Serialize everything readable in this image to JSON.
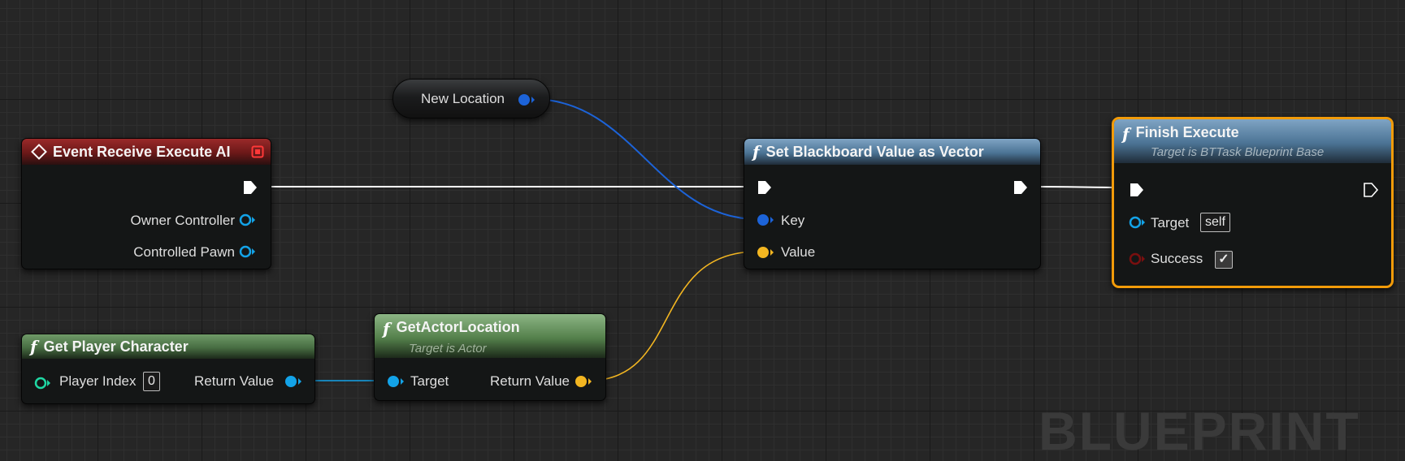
{
  "colors": {
    "exec_wire": "#ffffff",
    "vector_wire": "#f3b621",
    "blackboard_key_wire": "#1c63d8",
    "object_wire": "#13a3e8",
    "selected_outline": "#f29b09",
    "event_header": "#8b2020",
    "function_header": "#4b7394",
    "pure_header": "#476d42"
  },
  "variable_node": {
    "label": "New Location",
    "pin_type": "blackboard-key"
  },
  "event_node": {
    "title": "Event Receive Execute AI",
    "icon": "diamond-event-icon",
    "pins": {
      "owner_controller": "Owner Controller",
      "controlled_pawn": "Controlled Pawn"
    }
  },
  "set_node": {
    "title": "Set Blackboard Value as Vector",
    "icon": "function-icon",
    "pins": {
      "key": "Key",
      "value": "Value"
    }
  },
  "finish_node": {
    "title": "Finish Execute",
    "subtitle": "Target is BTTask Blueprint Base",
    "icon": "function-icon",
    "pins": {
      "target": "Target",
      "target_default": "self",
      "success": "Success",
      "success_checked": true
    }
  },
  "get_player_node": {
    "title": "Get Player Character",
    "icon": "function-icon",
    "pins": {
      "player_index": "Player Index",
      "player_index_value": "0",
      "return_value": "Return Value"
    }
  },
  "get_location_node": {
    "title": "GetActorLocation",
    "subtitle": "Target is Actor",
    "icon": "function-icon",
    "pins": {
      "target": "Target",
      "return_value": "Return Value"
    }
  },
  "watermark": "BLUEPRINT"
}
